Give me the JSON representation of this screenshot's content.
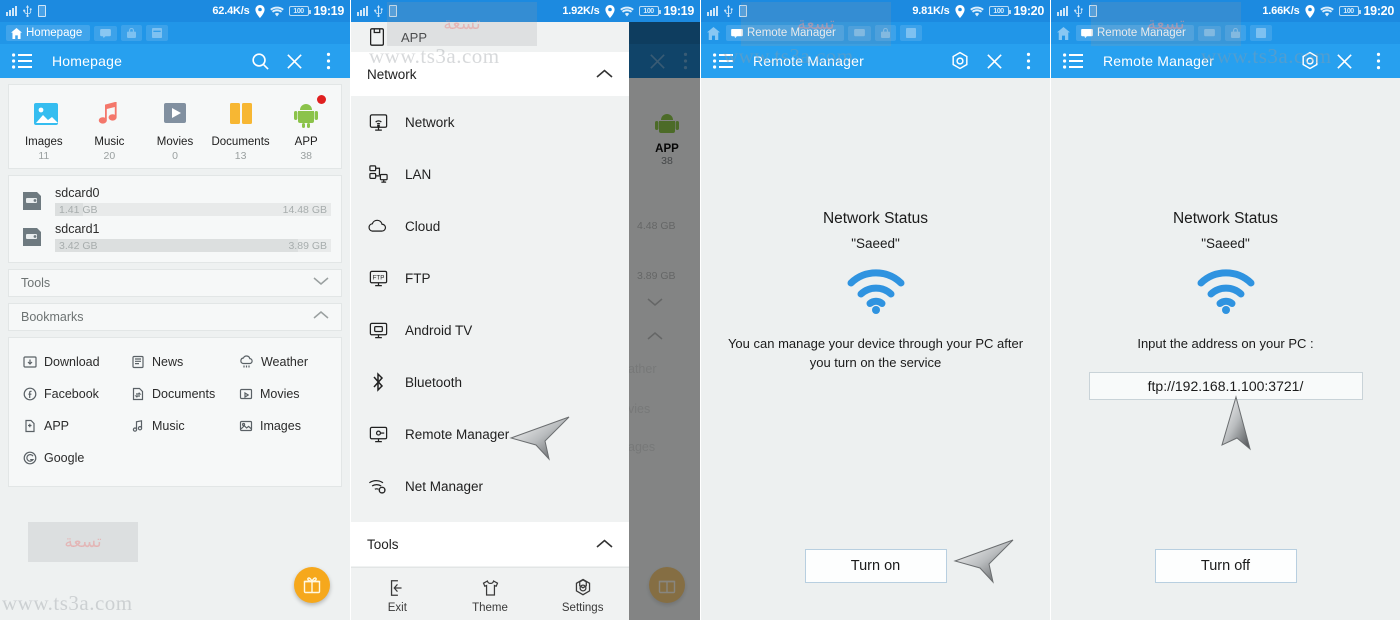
{
  "statusbar": {
    "icons": [
      "signal-icon",
      "usb-icon",
      "sim-icon",
      "location-icon",
      "wifi-icon",
      "battery-icon"
    ],
    "battery_level": "100",
    "panels": [
      {
        "speed": "62.4K/s",
        "time": "19:19"
      },
      {
        "speed": "1.92K/s",
        "time": "19:19"
      },
      {
        "speed": "9.81K/s",
        "time": "19:20"
      },
      {
        "speed": "1.66K/s",
        "time": "19:20"
      }
    ]
  },
  "watermark": {
    "url": "www.ts3a.com",
    "logo": "تسعة"
  },
  "accent": {
    "status_bar": "#1c8ae0",
    "tab_strip": "#2196e8",
    "toolbar": "#27a0ef",
    "fab": "#f6a81c",
    "wifi": "#2f93e0",
    "badge": "#e02020"
  },
  "panel1": {
    "tab_label": "Homepage",
    "toolbar_title": "Homepage",
    "toolbar_icons": [
      "menu-icon",
      "search-icon",
      "close-icon",
      "more-icon"
    ],
    "quick_access": [
      {
        "label": "Images",
        "count": "11",
        "icon": "images-icon",
        "color": "#35bdf0"
      },
      {
        "label": "Music",
        "count": "20",
        "icon": "music-icon",
        "color": "#f4776b"
      },
      {
        "label": "Movies",
        "count": "0",
        "icon": "movies-icon",
        "color": "#8190a0"
      },
      {
        "label": "Documents",
        "count": "13",
        "icon": "documents-icon",
        "color": "#f7b733"
      },
      {
        "label": "APP",
        "count": "38",
        "icon": "android-icon",
        "color": "#8bc34a"
      }
    ],
    "storage": [
      {
        "name": "sdcard0",
        "used": "1.41 GB",
        "total": "14.48 GB",
        "percent": 10
      },
      {
        "name": "sdcard1",
        "used": "3.42 GB",
        "total": "3.89 GB",
        "percent": 88
      }
    ],
    "sections": [
      {
        "label": "Tools",
        "state": "collapsed"
      },
      {
        "label": "Bookmarks",
        "state": "expanded"
      }
    ],
    "bookmarks": [
      {
        "label": "Download",
        "icon": "download-icon"
      },
      {
        "label": "News",
        "icon": "news-icon"
      },
      {
        "label": "Weather",
        "icon": "weather-icon"
      },
      {
        "label": "Facebook",
        "icon": "facebook-icon"
      },
      {
        "label": "Documents",
        "icon": "documents-bookmark-icon"
      },
      {
        "label": "Movies",
        "icon": "movies-bookmark-icon"
      },
      {
        "label": "APP",
        "icon": "app-bookmark-icon"
      },
      {
        "label": "Music",
        "icon": "music-bookmark-icon"
      },
      {
        "label": "Images",
        "icon": "images-bookmark-icon"
      },
      {
        "label": "Google",
        "icon": "google-icon"
      }
    ],
    "fab": "gift-icon"
  },
  "panel2": {
    "drawer_top_label": "APP",
    "network_header": "Network",
    "network_items": [
      {
        "label": "Network",
        "icon": "network-monitor-icon"
      },
      {
        "label": "LAN",
        "icon": "lan-icon"
      },
      {
        "label": "Cloud",
        "icon": "cloud-icon"
      },
      {
        "label": "FTP",
        "icon": "ftp-icon"
      },
      {
        "label": "Android TV",
        "icon": "android-tv-icon"
      },
      {
        "label": "Bluetooth",
        "icon": "bluetooth-icon"
      },
      {
        "label": "Remote Manager",
        "icon": "remote-manager-icon"
      },
      {
        "label": "Net Manager",
        "icon": "net-manager-icon"
      }
    ],
    "tools_header": "Tools",
    "footer": [
      {
        "label": "Exit",
        "icon": "exit-icon"
      },
      {
        "label": "Theme",
        "icon": "theme-icon"
      },
      {
        "label": "Settings",
        "icon": "settings-icon"
      }
    ]
  },
  "panel3": {
    "tab_label": "Remote Manager",
    "toolbar_title": "Remote Manager",
    "toolbar_icons": [
      "menu-icon",
      "gear-icon",
      "close-icon",
      "more-icon"
    ],
    "status_title": "Network Status",
    "network_name": "\"Saeed\"",
    "description": "You can manage your device through your PC after you turn on the service",
    "button_label": "Turn on"
  },
  "panel4": {
    "tab_label": "Remote Manager",
    "toolbar_title": "Remote Manager",
    "toolbar_icons": [
      "menu-icon",
      "gear-icon",
      "close-icon",
      "more-icon"
    ],
    "status_title": "Network Status",
    "network_name": "\"Saeed\"",
    "description": "Input the address on your PC :",
    "address": "ftp://192.168.1.100:3721/",
    "button_label": "Turn off"
  }
}
